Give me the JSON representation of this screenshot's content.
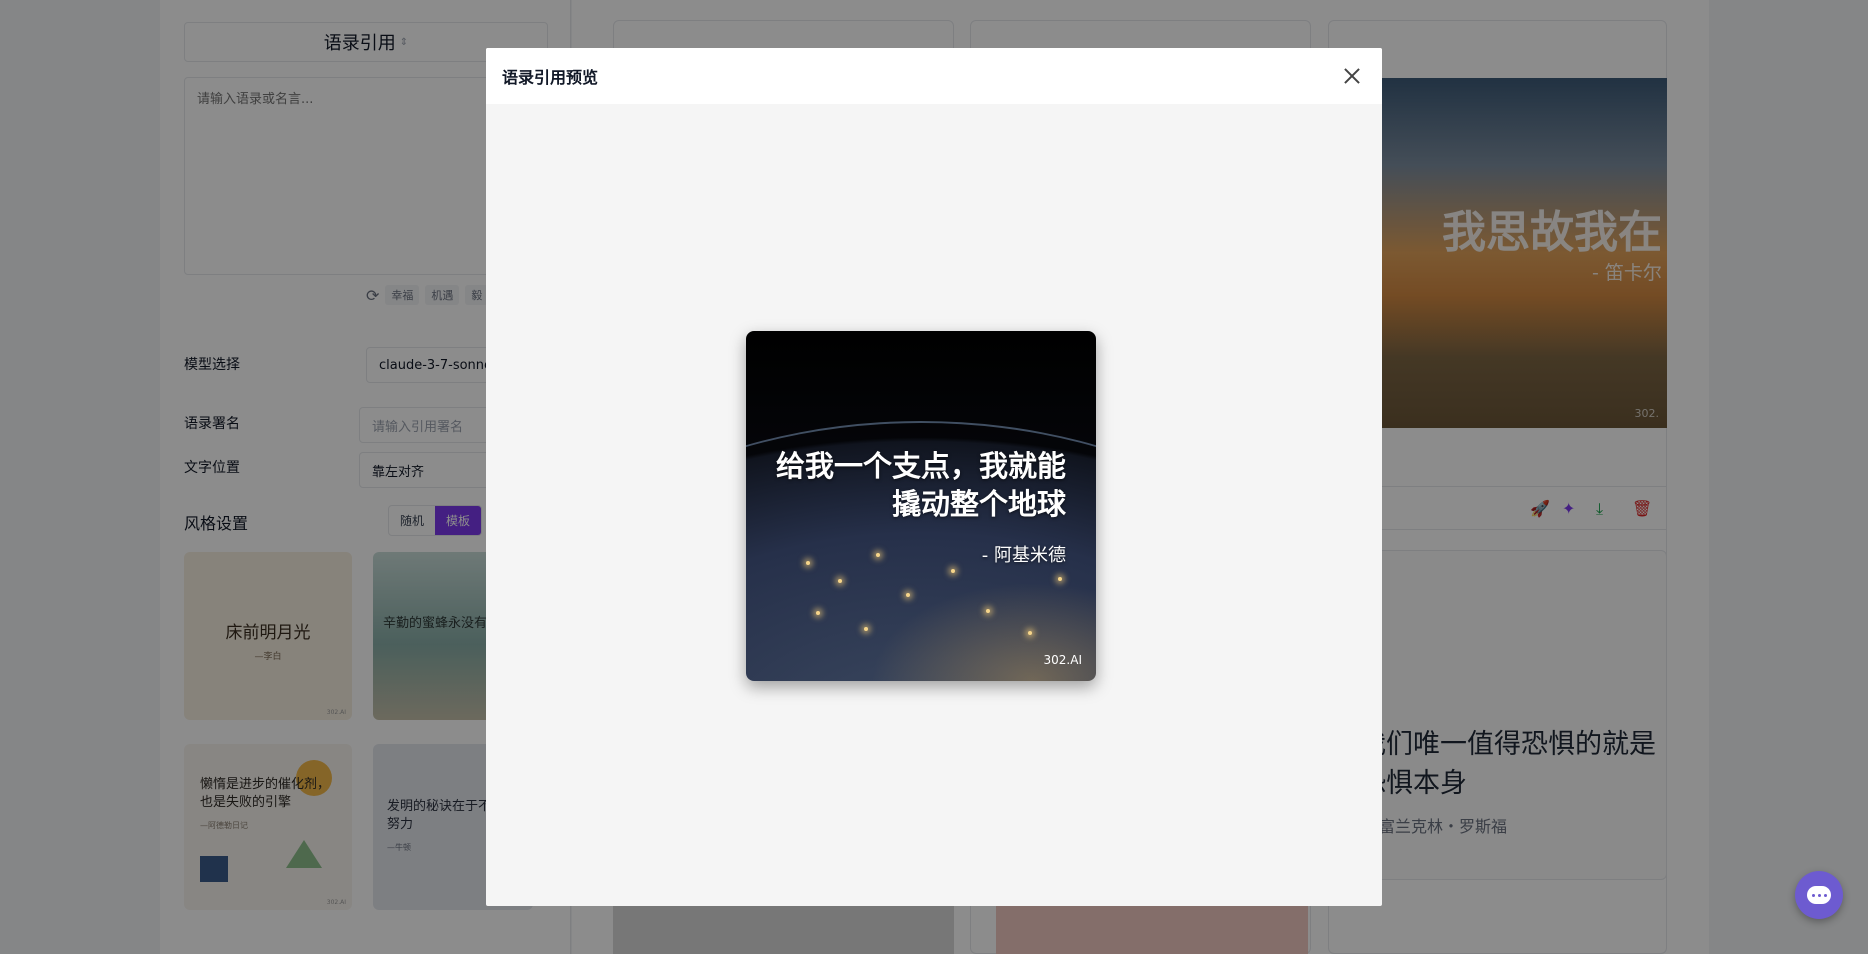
{
  "left_panel": {
    "title_select": "语录引用",
    "quote_placeholder": "请输入语录或名言...",
    "tags": [
      "幸福",
      "机遇",
      "毅"
    ],
    "model_label": "模型选择",
    "model_value": "claude-3-7-sonne",
    "signature_label": "语录署名",
    "signature_placeholder": "请输入引用署名",
    "position_label": "文字位置",
    "position_value": "靠左对齐",
    "style_title": "风格设置",
    "style_tabs": [
      "随机",
      "模板"
    ],
    "template_cards": [
      {
        "title": "床前明月光",
        "author": "—李白",
        "brand": "302.AI"
      },
      {
        "title": "辛勤的蜜蜂永没有",
        "author": "",
        "brand": ""
      },
      {
        "title": "懒惰是进步的催化剂，也是失败的引擎",
        "author": "—阿德勒日记",
        "brand": "302.AI"
      },
      {
        "title": "发明的秘诀在于不断的努力",
        "author": "—牛顿",
        "brand": ""
      }
    ]
  },
  "results": {
    "card1": {
      "quote": "我思故我在",
      "author": "- 笛卡尔",
      "brand": "302."
    },
    "card2": {
      "quote": "我们唯一值得恐惧的就是恐惧本身",
      "author": "富兰克林・罗斯福"
    }
  },
  "modal": {
    "title": "语录引用预览",
    "preview": {
      "quote": "给我一个支点，我就能撬动整个地球",
      "author": "- 阿基米德",
      "brand": "302.AI"
    }
  },
  "colors": {
    "accent": "#7c3aed",
    "fab": "#6d5bd0",
    "overlay": "rgba(0,0,0,0.45)"
  },
  "icons": {
    "close": "close-icon",
    "chat": "chat-icon",
    "refresh": "refresh-icon"
  }
}
